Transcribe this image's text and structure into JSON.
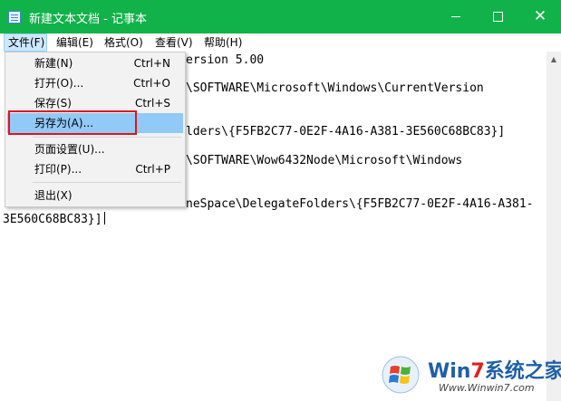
{
  "window": {
    "title": "新建文本文档 - 记事本",
    "close_glyph": "✕"
  },
  "menubar": {
    "items": [
      {
        "label": "文件(F)"
      },
      {
        "label": "编辑(E)"
      },
      {
        "label": "格式(O)"
      },
      {
        "label": "查看(V)"
      },
      {
        "label": "帮助(H)"
      }
    ]
  },
  "file_menu": {
    "items": [
      {
        "label": "新建(N)",
        "shortcut": "Ctrl+N"
      },
      {
        "label": "打开(O)...",
        "shortcut": "Ctrl+O"
      },
      {
        "label": "保存(S)",
        "shortcut": "Ctrl+S"
      },
      {
        "label": "另存为(A)...",
        "shortcut": ""
      },
      {
        "label": "页面设置(U)...",
        "shortcut": ""
      },
      {
        "label": "打印(P)...",
        "shortcut": "Ctrl+P"
      },
      {
        "label": "退出(X)",
        "shortcut": ""
      }
    ]
  },
  "editor": {
    "lines": [
      "ersion 5.00",
      "\\SOFTWARE\\Microsoft\\Windows\\CurrentVersion",
      "lders\\{F5FB2C77-0E2F-4A16-A381-3E560C68BC83}]",
      "\\SOFTWARE\\Wow6432Node\\Microsoft\\Windows",
      "neSpace\\DelegateFolders\\{F5FB2C77-0E2F-4A16-A381-",
      "3E560C68BC83}]"
    ]
  },
  "watermark": {
    "brand_part1": "Win",
    "brand_part2": "7",
    "brand_part3": "系统之家",
    "url": "Www.Winwin7.com"
  },
  "colors": {
    "titlebar": "#12b24a",
    "menu_hover": "#91c9f7",
    "highlight_border": "#e0141e"
  }
}
